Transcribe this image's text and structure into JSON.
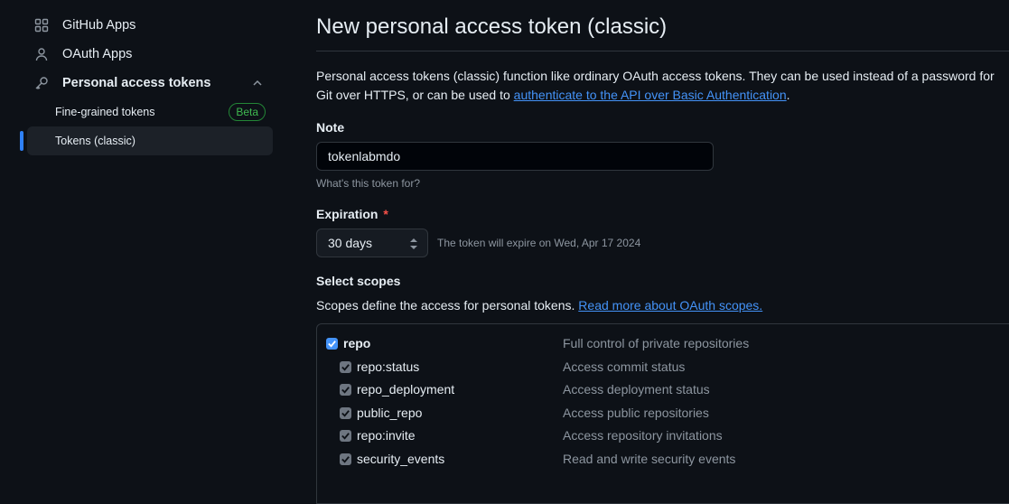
{
  "sidebar": {
    "github_apps": "GitHub Apps",
    "oauth_apps": "OAuth Apps",
    "pat": "Personal access tokens",
    "fine_grained": "Fine-grained tokens",
    "beta": "Beta",
    "classic": "Tokens (classic)"
  },
  "main": {
    "title": "New personal access token (classic)",
    "desc_pre": "Personal access tokens (classic) function like ordinary OAuth access tokens. They can be used instead of a password for Git over HTTPS, or can be used to ",
    "desc_link": "authenticate to the API over Basic Authentication",
    "desc_post": ".",
    "note_label": "Note",
    "note_value": "tokenlabmdo",
    "note_hint": "What's this token for?",
    "expiration_label": "Expiration",
    "required_mark": "*",
    "expiration_value": "30 days",
    "expiration_note": "The token will expire on Wed, Apr 17 2024",
    "scopes_label": "Select scopes",
    "scopes_desc": "Scopes define the access for personal tokens.",
    "scopes_link": "Read more about OAuth scopes."
  },
  "scopes": [
    {
      "name": "repo",
      "desc": "Full control of private repositories"
    },
    {
      "name": "repo:status",
      "desc": "Access commit status"
    },
    {
      "name": "repo_deployment",
      "desc": "Access deployment status"
    },
    {
      "name": "public_repo",
      "desc": "Access public repositories"
    },
    {
      "name": "repo:invite",
      "desc": "Access repository invitations"
    },
    {
      "name": "security_events",
      "desc": "Read and write security events"
    }
  ],
  "colors": {
    "accent": "#4493f8",
    "active_bar": "#2f81f7",
    "beta_green": "#3fb950",
    "required_red": "#f85149"
  }
}
